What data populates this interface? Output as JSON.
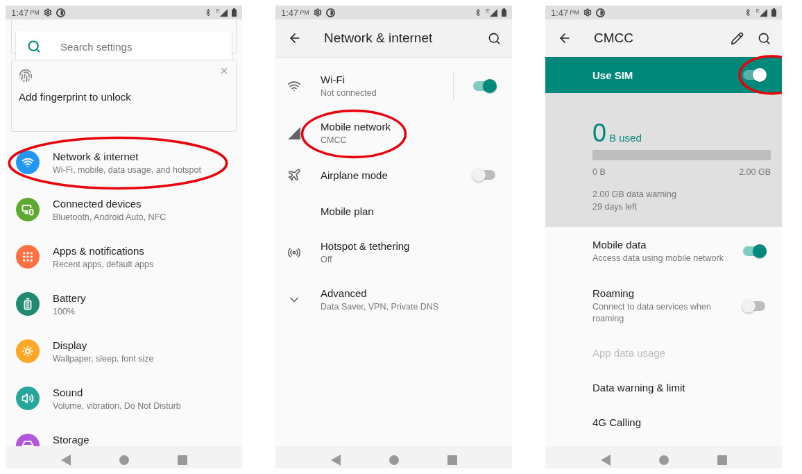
{
  "screens": [
    {
      "kind": "home",
      "status_bar": {
        "time": "1:47",
        "period": "PM",
        "network": "E"
      },
      "search": {
        "placeholder": "Search settings"
      },
      "suggestion": {
        "title": "Add fingerprint to unlock"
      },
      "items": [
        {
          "title": "Network & internet",
          "subtitle": "Wi-Fi, mobile, data usage, and hotspot",
          "color": "#2196f3",
          "circled": true
        },
        {
          "title": "Connected devices",
          "subtitle": "Bluetooth, Android Auto, NFC",
          "color": "#5fa832",
          "circled": false
        },
        {
          "title": "Apps & notifications",
          "subtitle": "Recent apps, default apps",
          "color": "#ff7043",
          "circled": false
        },
        {
          "title": "Battery",
          "subtitle": "100%",
          "color": "#1f8a6f",
          "circled": false
        },
        {
          "title": "Display",
          "subtitle": "Wallpaper, sleep, font size",
          "color": "#ffa726",
          "circled": false
        },
        {
          "title": "Sound",
          "subtitle": "Volume, vibration, Do Not Disturb",
          "color": "#26a69a",
          "circled": false
        },
        {
          "title": "Storage",
          "color": "#b455e0",
          "circled": false
        }
      ]
    },
    {
      "kind": "detail",
      "status_bar": {
        "time": "1:47",
        "period": "PM",
        "network": "E"
      },
      "toolbar": {
        "title": "Network & internet"
      },
      "items": [
        {
          "title": "Wi-Fi",
          "subtitle": "Not connected",
          "on": true,
          "circled": false
        },
        {
          "title": "Mobile network",
          "subtitle": "CMCC",
          "circled": true
        },
        {
          "title": "Airplane mode",
          "on": false,
          "circled": false
        },
        {
          "title": "Mobile plan",
          "circled": false
        },
        {
          "title": "Hotspot & tethering",
          "subtitle": "Off",
          "circled": false
        },
        {
          "title": "Advanced",
          "subtitle": "Data Saver, VPN, Private DNS",
          "circled": false
        }
      ]
    },
    {
      "kind": "detail",
      "status_bar": {
        "time": "1:47",
        "period": "PM",
        "network": "E"
      },
      "toolbar": {
        "title": "CMCC"
      },
      "sim_switch": {
        "label": "Use SIM",
        "on": true,
        "circled": true
      },
      "usage": {
        "amount": "0",
        "unit": "B used",
        "level": 0,
        "min": "0 B",
        "max": "2.00 GB",
        "warning": "2.00 GB data warning",
        "days_left": "29 days left"
      },
      "items": [
        {
          "title": "Mobile data",
          "subtitle": "Access data using mobile network",
          "on": true,
          "disabled": false
        },
        {
          "title": "Roaming",
          "subtitle": "Connect to data services when roaming",
          "on": false,
          "disabled": false
        },
        {
          "title": "App data usage",
          "disabled": true
        },
        {
          "title": "Data warning & limit",
          "disabled": false
        },
        {
          "title": "4G Calling",
          "disabled": false
        }
      ]
    }
  ]
}
